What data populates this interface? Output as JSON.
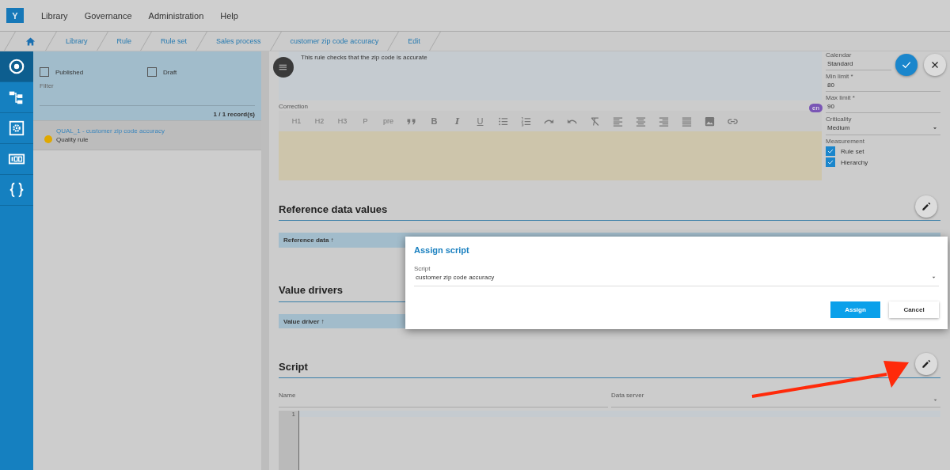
{
  "app": {
    "logo": "Y",
    "menu": [
      "Library",
      "Governance",
      "Administration",
      "Help"
    ]
  },
  "breadcrumb": [
    "Library",
    "Rule",
    "Rule set",
    "Sales process",
    "customer zip code accuracy",
    "Edit"
  ],
  "nav": [
    {
      "kind": "eye",
      "selected": true
    },
    {
      "kind": "hierarchy",
      "selected": false
    },
    {
      "kind": "gear-box",
      "selected": false
    },
    {
      "kind": "counter",
      "selected": false
    },
    {
      "kind": "braces",
      "selected": false
    }
  ],
  "list": {
    "filters": [
      {
        "label": "Published",
        "checked": false
      },
      {
        "label": "Draft",
        "checked": false
      }
    ],
    "filter_label": "Filter",
    "count": "1 / 1 record(s)",
    "items": [
      {
        "title": "QUAL_1 - customer zip code accuracy",
        "subtitle": "Quality rule",
        "color": "#e0a800",
        "selected": true
      }
    ]
  },
  "editor": {
    "description": "This rule checks that the zip code is accurate",
    "correction_label": "Correction",
    "language": "en",
    "toolbar": [
      {
        "kind": "text",
        "label": "H1"
      },
      {
        "kind": "text",
        "label": "H2"
      },
      {
        "kind": "text",
        "label": "H3"
      },
      {
        "kind": "text",
        "label": "P"
      },
      {
        "kind": "text",
        "label": "pre"
      },
      {
        "kind": "quote"
      },
      {
        "kind": "bold",
        "label": "B"
      },
      {
        "kind": "italic",
        "label": "I"
      },
      {
        "kind": "underline",
        "label": "U"
      },
      {
        "kind": "bullets"
      },
      {
        "kind": "numbers"
      },
      {
        "kind": "redo"
      },
      {
        "kind": "undo"
      },
      {
        "kind": "clear"
      },
      {
        "kind": "align-left"
      },
      {
        "kind": "align-center"
      },
      {
        "kind": "align-right"
      },
      {
        "kind": "justify"
      },
      {
        "kind": "image"
      },
      {
        "kind": "link"
      }
    ]
  },
  "properties": [
    {
      "kind": "text",
      "label": "Calendar",
      "value": "Standard"
    },
    {
      "kind": "text",
      "label": "Min limit *",
      "value": "80"
    },
    {
      "kind": "text",
      "label": "Max limit *",
      "value": "90"
    },
    {
      "kind": "select",
      "label": "Criticality",
      "value": "Medium"
    },
    {
      "kind": "checks",
      "label": "Measurement",
      "options": [
        {
          "label": "Rule set",
          "checked": true
        },
        {
          "label": "Hierarchy",
          "checked": true
        }
      ]
    }
  ],
  "sections": [
    {
      "title": "Reference data values",
      "edit_button": true,
      "columns": [
        {
          "label": "Reference data",
          "sort": "↑"
        }
      ]
    },
    {
      "title": "Value drivers",
      "columns": [
        {
          "label": "Value driver",
          "sort": "↑"
        }
      ]
    },
    {
      "title": "Script",
      "edit_button": true,
      "fields": [
        {
          "label": "Name",
          "kind": "text"
        },
        {
          "label": "Data server",
          "kind": "select"
        }
      ],
      "line_numbers": [
        "1"
      ]
    }
  ],
  "dialog": {
    "title": "Assign script",
    "field_label": "Script",
    "value": "customer zip code accuracy",
    "buttons": [
      {
        "label": "Assign",
        "kind": "primary"
      },
      {
        "label": "Cancel",
        "kind": "secondary"
      }
    ]
  }
}
